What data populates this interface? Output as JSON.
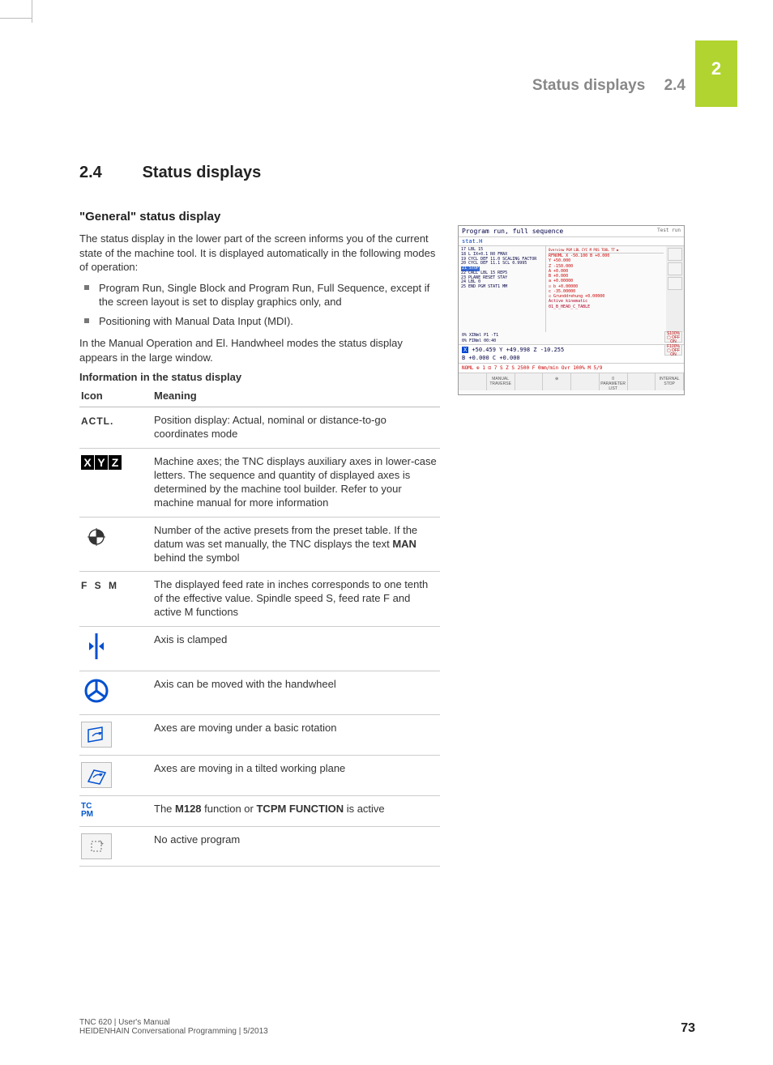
{
  "chapter_tab": "2",
  "running_head": {
    "title": "Status displays",
    "section": "2.4"
  },
  "heading": {
    "number": "2.4",
    "title": "Status displays"
  },
  "subheading": "\"General\" status display",
  "intro": "The status display in the lower part of the screen informs you of the current state of the machine tool. It is displayed automatically in the following modes of operation:",
  "bullets": [
    "Program Run, Single Block and Program Run, Full Sequence, except if the screen layout is set to display graphics only, and",
    "Positioning with Manual Data Input (MDI)."
  ],
  "para2": "In the Manual Operation and El. Handwheel modes the status display appears in the large window.",
  "table_caption": "Information in the status display",
  "table": {
    "head_icon": "Icon",
    "head_meaning": "Meaning",
    "rows": [
      {
        "icon": "actl",
        "meaning": "Position display: Actual, nominal or distance-to-go coordinates mode"
      },
      {
        "icon": "xyz",
        "meaning": "Machine axes; the TNC displays auxiliary axes in lower-case letters. The sequence and quantity of displayed axes is determined by the machine tool builder. Refer to your machine manual for more information"
      },
      {
        "icon": "preset",
        "meaning": "Number of the active presets from the preset table. If the datum was set manually, the TNC displays the text MAN behind the symbol",
        "bold_inline": "MAN"
      },
      {
        "icon": "fsm",
        "meaning": "The displayed feed rate in inches corresponds to one tenth of the effective value. Spindle speed S, feed rate F and active M functions"
      },
      {
        "icon": "clamp",
        "meaning": "Axis is clamped"
      },
      {
        "icon": "handwheel",
        "meaning": "Axis can be moved with the handwheel"
      },
      {
        "icon": "basicrot",
        "meaning": "Axes are moving under a basic rotation"
      },
      {
        "icon": "tilted",
        "meaning": "Axes are moving in a tilted working plane"
      },
      {
        "icon": "tcpm",
        "meaning_pre": "The ",
        "meaning_b1": "M128",
        "meaning_mid": " function or ",
        "meaning_b2": "TCPM FUNCTION",
        "meaning_post": " is active"
      },
      {
        "icon": "noprog",
        "meaning": "No active program"
      }
    ]
  },
  "screenshot": {
    "title_left": "Program run, full sequence",
    "title_right": "Test run",
    "subtitle": "stat.H",
    "code_lines": [
      "17 LBL 15",
      "18 L IX+0.1 R0 FMAX",
      "19 CYCL DEF 11.0 SCALING FACTOR",
      "20 CYCL DEF 11.1 SCL 0.9995",
      "21 STOP",
      "22 CALL LBL 15 REP5",
      "23 PLANE RESET STAY",
      "24 LBL 0",
      "25 END PGM STAT1 MM"
    ],
    "highlight_index": 4,
    "panel_tabs": "Overview PGM LBL CYC M POS TOOL TT ▶",
    "panel_lines": [
      "RFNOML X    -50.100   B   +0.000",
      "       Y    +50.000",
      "       Z   -150.000",
      "       A     +0.000",
      "       B     +0.000",
      "",
      "  a   +0.00000",
      "☑ b   +0.00000",
      "  c  -35.00000",
      "",
      "☑ Grunddrehung   +0.00000",
      "Active kinematic",
      "01_B_HEAD_C_TABLE"
    ],
    "foot_line1": "0% XINml P1 -T1",
    "foot_line2": "0% FINml 00:40",
    "pos_line1_x": "X",
    "pos_line1": "  +50.459  Y   +49.998  Z      -10.255",
    "pos_line2": "B   +0.000   C    +0.000",
    "status_line": "NOML ⊕ 1   ⊡ 7  S Z S 2500 F  0mm/min   Ovr 100% M 5/9",
    "softkeys": [
      "",
      "MANUAL TRAVERSE",
      "",
      "⊕",
      "",
      "0 PARAMETER LIST",
      "",
      "INTERNAL STOP"
    ],
    "overrides": [
      "S100% ▢ OFF ON",
      "F100% ▢ OFF ON"
    ]
  },
  "footer": {
    "line1": "TNC 620 | User's Manual",
    "line2": "HEIDENHAIN Conversational Programming | 5/2013",
    "page": "73"
  }
}
